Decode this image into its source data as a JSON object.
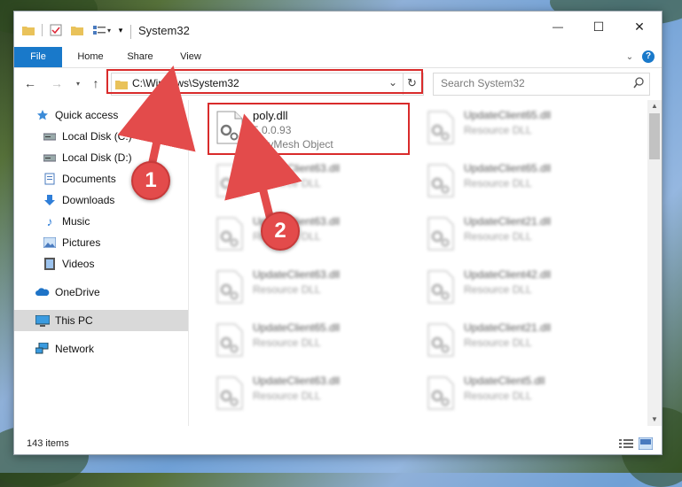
{
  "window": {
    "title": "System32",
    "controls": {
      "minimize": "—",
      "maximize": "☐",
      "close": "✕"
    }
  },
  "ribbon": {
    "tabs": [
      {
        "label": "File"
      },
      {
        "label": "Home"
      },
      {
        "label": "Share"
      },
      {
        "label": "View"
      }
    ],
    "expand_icon": "chevron-down-icon",
    "help_icon": "?"
  },
  "address": {
    "path": "C:\\Windows\\System32",
    "search_placeholder": "Search System32"
  },
  "sidebar": {
    "items": [
      {
        "label": "Quick access",
        "icon": "star-icon"
      },
      {
        "label": "Local Disk (C:)",
        "icon": "drive-icon",
        "pinned": true
      },
      {
        "label": "Local Disk (D:)",
        "icon": "drive-icon",
        "pinned": true
      },
      {
        "label": "Documents",
        "icon": "documents-icon",
        "pinned": true
      },
      {
        "label": "Downloads",
        "icon": "download-icon",
        "pinned": true
      },
      {
        "label": "Music",
        "icon": "music-icon",
        "pinned": true
      },
      {
        "label": "Pictures",
        "icon": "pictures-icon",
        "pinned": true
      },
      {
        "label": "Videos",
        "icon": "videos-icon",
        "pinned": true
      },
      {
        "label": "OneDrive",
        "icon": "cloud-icon"
      },
      {
        "label": "This PC",
        "icon": "computer-icon",
        "selected": true
      },
      {
        "label": "Network",
        "icon": "network-icon"
      }
    ]
  },
  "files": [
    {
      "name": "poly.dll",
      "line2": "5.0.0.93",
      "line3": "PolyMesh Object",
      "highlighted": true
    },
    {
      "name": "UpdateClient65.dll",
      "line2": "Resource DLL"
    },
    {
      "name": "UpdateClient63.dll",
      "line2": "Resource DLL"
    },
    {
      "name": "UpdateClient65.dll",
      "line2": "Resource DLL"
    },
    {
      "name": "UpdateClient63.dll",
      "line2": "Resource DLL"
    },
    {
      "name": "UpdateClient21.dll",
      "line2": "Resource DLL"
    },
    {
      "name": "UpdateClient63.dll",
      "line2": "Resource DLL"
    },
    {
      "name": "UpdateClient42.dll",
      "line2": "Resource DLL"
    },
    {
      "name": "UpdateClient65.dll",
      "line2": "Resource DLL"
    },
    {
      "name": "UpdateClient21.dll",
      "line2": "Resource DLL"
    },
    {
      "name": "UpdateClient63.dll",
      "line2": "Resource DLL"
    },
    {
      "name": "UpdateClient5.dll",
      "line2": "Resource DLL"
    }
  ],
  "status": {
    "item_count": "143 items"
  },
  "callouts": [
    {
      "number": "1"
    },
    {
      "number": "2"
    }
  ],
  "colors": {
    "accent": "#1979ca",
    "highlight": "#d92b2b",
    "callout": "#e34b4b"
  }
}
